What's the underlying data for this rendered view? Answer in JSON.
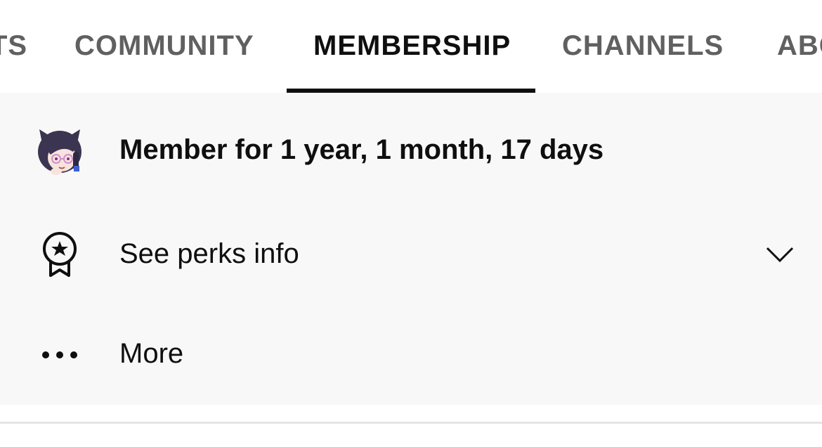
{
  "tabs": [
    {
      "label": "TS",
      "active": false
    },
    {
      "label": "COMMUNITY",
      "active": false
    },
    {
      "label": "MEMBERSHIP",
      "active": true
    },
    {
      "label": "CHANNELS",
      "active": false
    },
    {
      "label": "ABC",
      "active": false
    }
  ],
  "membership": {
    "member_duration": "Member for 1 year, 1 month, 17 days",
    "badge_icon": "member-badge-avatar",
    "perks_label": "See perks info",
    "perks_icon": "award-star-icon",
    "more_label": "More",
    "more_icon": "more-dots-icon"
  },
  "colors": {
    "panel_background": "#f8f8f8",
    "active_tab": "#0f0f0f",
    "inactive_tab": "#606060",
    "underline": "#0f0f0f"
  }
}
